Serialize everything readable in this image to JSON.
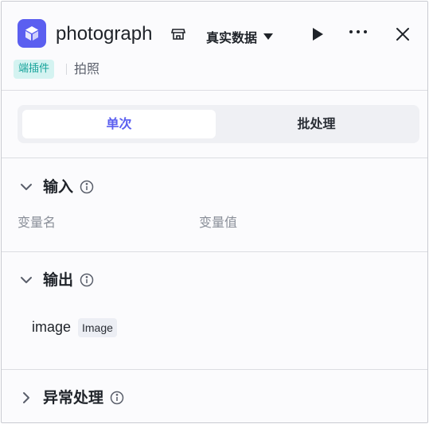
{
  "header": {
    "title": "photograph",
    "data_mode": "真实数据",
    "badge": "端插件",
    "subtitle": "拍照",
    "icon_color": "#5b5ff0"
  },
  "tabs": [
    {
      "label": "单次",
      "active": true
    },
    {
      "label": "批处理",
      "active": false
    }
  ],
  "input_section": {
    "title": "输入",
    "columns": [
      "变量名",
      "变量值"
    ]
  },
  "output_section": {
    "title": "输出",
    "items": [
      {
        "name": "image",
        "type": "Image"
      }
    ]
  },
  "exception_section": {
    "title": "异常处理"
  },
  "colors": {
    "accent": "#5b5ff0",
    "badge_bg": "#d4f3f1",
    "badge_text": "#16a39a"
  }
}
